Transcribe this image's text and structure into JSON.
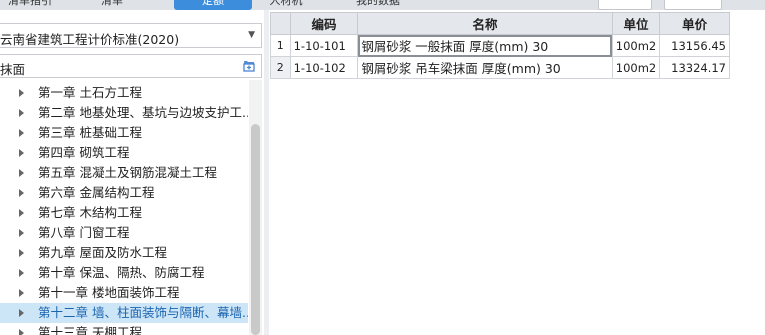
{
  "tabs": [
    {
      "label": "清单指引",
      "active": false
    },
    {
      "label": "清单",
      "active": false
    },
    {
      "label": "定额",
      "active": true
    },
    {
      "label": "人材机",
      "active": false
    },
    {
      "label": "我的数据",
      "active": false
    }
  ],
  "left": {
    "standard_select": {
      "value": "云南省建筑工程计价标准(2020)",
      "icon": "chevron-down-icon"
    },
    "search": {
      "value": "抹面",
      "icon": "search-folder-icon"
    },
    "tree": [
      {
        "label": "第一章 土石方工程",
        "selected": false
      },
      {
        "label": "第二章 地基处理、基坑与边坡支护工...",
        "selected": false
      },
      {
        "label": "第三章 桩基础工程",
        "selected": false
      },
      {
        "label": "第四章 砌筑工程",
        "selected": false
      },
      {
        "label": "第五章 混凝土及钢筋混凝土工程",
        "selected": false
      },
      {
        "label": "第六章 金属结构工程",
        "selected": false
      },
      {
        "label": "第七章 木结构工程",
        "selected": false
      },
      {
        "label": "第八章 门窗工程",
        "selected": false
      },
      {
        "label": "第九章 屋面及防水工程",
        "selected": false
      },
      {
        "label": "第十章 保温、隔热、防腐工程",
        "selected": false
      },
      {
        "label": "第十一章 楼地面装饰工程",
        "selected": false
      },
      {
        "label": "第十二章 墙、柱面装饰与隔断、幕墙...",
        "selected": true
      },
      {
        "label": "第十三章 天棚工程",
        "selected": false
      }
    ]
  },
  "grid": {
    "headers": {
      "code": "编码",
      "name": "名称",
      "unit": "单位",
      "price": "单价"
    },
    "rows": [
      {
        "row": "1",
        "code": "1-10-101",
        "name": "钢屑砂浆 一般抹面 厚度(mm) 30",
        "unit": "100m2",
        "price": "13156.45"
      },
      {
        "row": "2",
        "code": "1-10-102",
        "name": "钢屑砂浆 吊车梁抹面 厚度(mm) 30",
        "unit": "100m2",
        "price": "13324.17"
      }
    ]
  }
}
